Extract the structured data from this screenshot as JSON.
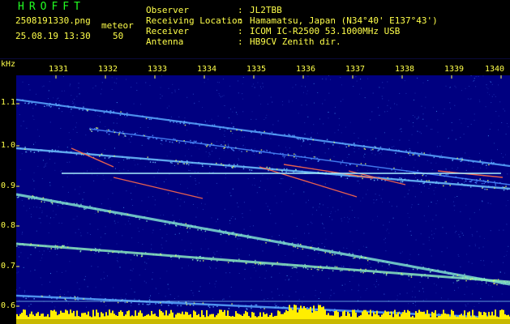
{
  "header": {
    "app_title": "HROFFT",
    "filename": "2508191330.png",
    "mode_label": "meteor",
    "datetime": "25.08.19 13:30",
    "level": "50",
    "fields": [
      {
        "label": "Observer",
        "value": "JL2TBB"
      },
      {
        "label": "Receiving Location",
        "value": "Hamamatsu, Japan (N34°40' E137°43')"
      },
      {
        "label": "Receiver",
        "value": "ICOM IC-R2500 53.1000MHz USB"
      },
      {
        "label": "Antenna",
        "value": "HB9CV Zenith dir."
      }
    ]
  },
  "axes": {
    "y_unit": "kHz",
    "y_ticks": [
      "1.1",
      "1.0",
      "0.9",
      "0.8",
      "0.7",
      "0.6"
    ],
    "x_ticks": [
      "1331",
      "1332",
      "1333",
      "1334",
      "1335",
      "1336",
      "1337",
      "1338",
      "1339",
      "1340"
    ]
  },
  "colors": {
    "header_text": "#ffff4a",
    "title_text": "#22ff22",
    "background": "#000080",
    "trace": "#6fc3ff",
    "meteor": "#ff6a4a",
    "carrier": "#a8f0ff",
    "noise_bar": "#ffee00"
  }
}
